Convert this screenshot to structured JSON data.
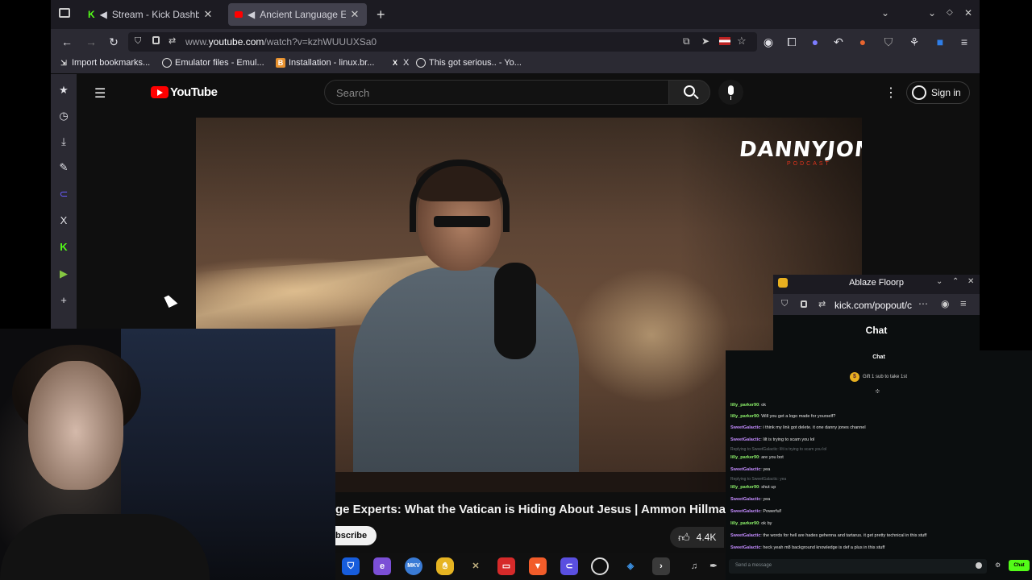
{
  "browser": {
    "tabs": [
      {
        "label": "Stream - Kick Dashboard",
        "favicon": "kick-icon",
        "audio": true
      },
      {
        "label": "Ancient Language Expert",
        "favicon": "youtube-icon",
        "audio": true
      }
    ],
    "new_tab": "+",
    "url": {
      "prefix": "www.",
      "host": "youtube.com",
      "path": "/watch?v=kzhWUUUXSa0"
    },
    "bookmarks": [
      {
        "label": "Import bookmarks...",
        "icon": "import-icon"
      },
      {
        "label": "Emulator files - Emul...",
        "icon": "globe-icon"
      },
      {
        "label": "Installation - linux.br...",
        "icon": "brave-icon"
      },
      {
        "label": "X",
        "icon": "x-icon"
      },
      {
        "label": "This got serious.. - Yo...",
        "icon": "globe-icon"
      }
    ]
  },
  "youtube": {
    "logo_text": "YouTube",
    "search_placeholder": "Search",
    "sign_in": "Sign in",
    "video_title": "ge Experts: What the Vatican is Hiding About Jesus | Ammon Hillman",
    "subscribe": "bscribe",
    "likes": "4.4K",
    "watermark": "DANNYJONES",
    "watermark_sub": "PODCAST"
  },
  "floorp": {
    "title": "Ablaze Floorp",
    "url": "kick.com/popout/c",
    "chat_header": "Chat"
  },
  "chat": {
    "title": "Chat",
    "gift": "Gift 1 sub to take 1st",
    "messages": [
      {
        "user": "lilly_parker90",
        "text": "ok",
        "color": "#8ef56b"
      },
      {
        "user": "lilly_parker90",
        "text": "Will you get a logo made for yourself?",
        "color": "#8ef56b"
      },
      {
        "user": "SweetGalactic",
        "text": "i think my link got delete. it one danny jones channel",
        "color": "#c48cff"
      },
      {
        "user": "SweetGalactic",
        "text": "lilt is trying to scam you lol",
        "color": "#c48cff"
      },
      {
        "reply": "Replying to SweetGalactic: lilt is trying to scam you lol"
      },
      {
        "user": "lilly_parker90",
        "text": "are you bot",
        "color": "#8ef56b"
      },
      {
        "user": "SweetGalactic",
        "text": "yea",
        "color": "#c48cff"
      },
      {
        "reply": "Replying to SweetGalactic: yea"
      },
      {
        "user": "lilly_parker90",
        "text": "shut up",
        "color": "#8ef56b"
      },
      {
        "user": "SweetGalactic",
        "text": "yea",
        "color": "#c48cff"
      },
      {
        "user": "SweetGalactic",
        "text": "Powerful!",
        "color": "#c48cff"
      },
      {
        "user": "lilly_parker90",
        "text": "ok by",
        "color": "#8ef56b"
      },
      {
        "user": "SweetGalactic",
        "text": "the words for hell are hades gehenna and tartarus. it get pretty technical in this stuff",
        "color": "#c48cff"
      },
      {
        "user": "SweetGalactic",
        "text": "heck yeah m8 background knowledge is def a plus in this stuff",
        "color": "#c48cff"
      }
    ],
    "input_placeholder": "Send a message",
    "send_label": "Chat"
  },
  "taskbar": {
    "apps": [
      "bitwarden-icon",
      "edge-icon",
      "mkv-icon",
      "hand-icon",
      "xbox-icon",
      "app-icon",
      "brave-icon",
      "floorp-icon",
      "obs-icon",
      "vscode-icon",
      "terminal-icon"
    ],
    "mkv_label": "MKV"
  },
  "colors": {
    "kick_green": "#53fc18",
    "youtube_red": "#ff0000",
    "browser_dark": "#1c1b22"
  }
}
